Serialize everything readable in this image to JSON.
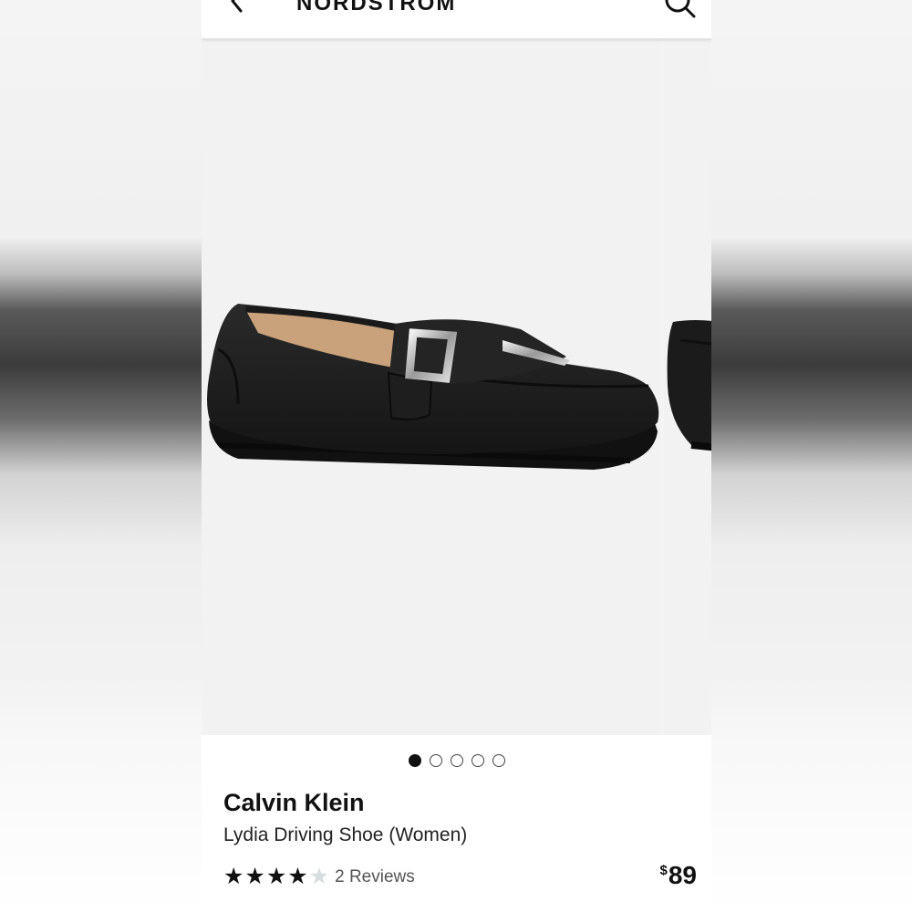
{
  "header": {
    "logo_text": "NORDSTROM",
    "back_icon": "chevron-left-icon",
    "search_icon": "search-icon"
  },
  "gallery": {
    "images": [
      "black-buckle-loafer-image",
      "black-loafer-side-image"
    ],
    "dots_count": 5,
    "active_index": 0
  },
  "product": {
    "brand": "Calvin Klein",
    "name": "Lydia Driving Shoe (Women)",
    "rating": 4,
    "rating_max": 5,
    "reviews_text": "2 Reviews",
    "price_symbol": "$",
    "price_value": "89"
  },
  "colors": {
    "star_filled": "#111111",
    "star_empty": "#d8dde0",
    "gallery_bg": "#f2f2f2"
  }
}
